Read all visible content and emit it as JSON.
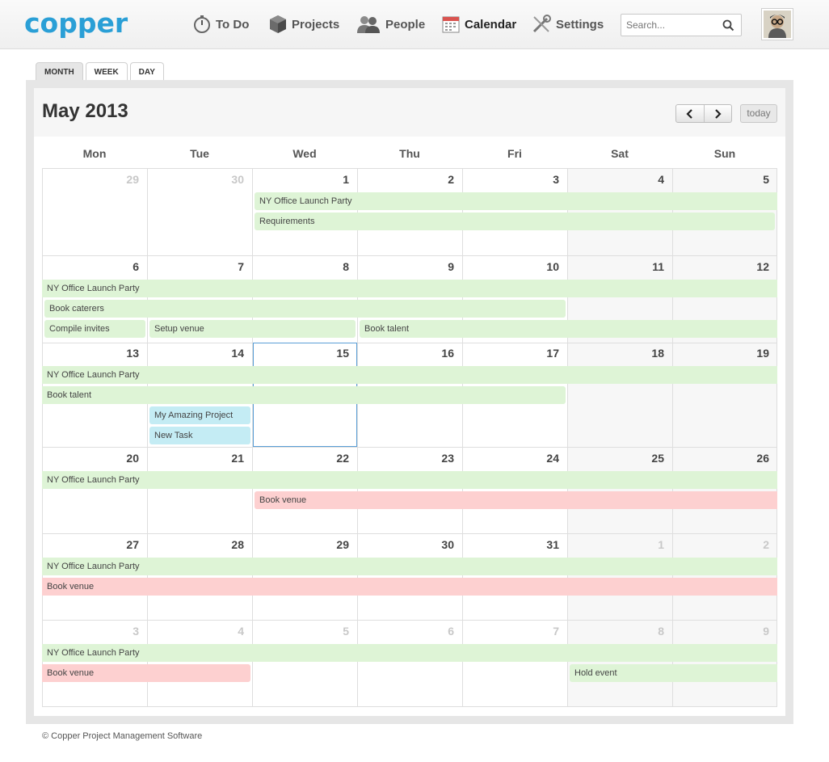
{
  "app": {
    "brand": "copper",
    "nav": [
      {
        "label": "To Do",
        "icon": "stopwatch-icon"
      },
      {
        "label": "Projects",
        "icon": "box-icon"
      },
      {
        "label": "People",
        "icon": "people-icon"
      },
      {
        "label": "Calendar",
        "icon": "calendar-icon",
        "active": true
      },
      {
        "label": "Settings",
        "icon": "wrench-icon"
      }
    ],
    "search_placeholder": "Search..."
  },
  "views": {
    "month": "MONTH",
    "week": "WEEK",
    "day": "DAY",
    "active": "month"
  },
  "calendar": {
    "title": "May 2013",
    "today_label": "today",
    "weekdays": [
      "Mon",
      "Tue",
      "Wed",
      "Thu",
      "Fri",
      "Sat",
      "Sun"
    ],
    "weeks": [
      [
        "29",
        "30",
        "1",
        "2",
        "3",
        "4",
        "5"
      ],
      [
        "6",
        "7",
        "8",
        "9",
        "10",
        "11",
        "12"
      ],
      [
        "13",
        "14",
        "15",
        "16",
        "17",
        "18",
        "19"
      ],
      [
        "20",
        "21",
        "22",
        "23",
        "24",
        "25",
        "26"
      ],
      [
        "27",
        "28",
        "29",
        "30",
        "31",
        "1",
        "2"
      ],
      [
        "3",
        "4",
        "5",
        "6",
        "7",
        "8",
        "9"
      ]
    ],
    "events": {
      "w1_party": "NY Office Launch Party",
      "w1_requirements": "Requirements",
      "w2_party": "NY Office Launch Party",
      "w2_caterers": "Book caterers",
      "w2_invites": "Compile invites",
      "w2_setup": "Setup venue",
      "w2_talent": "Book talent",
      "w3_party": "NY Office Launch Party",
      "w3_talent": "Book talent",
      "w3_project": "My Amazing Project",
      "w3_task": "New Task",
      "w4_party": "NY Office Launch Party",
      "w4_venue": "Book venue",
      "w5_party": "NY Office Launch Party",
      "w5_venue": "Book venue",
      "w6_party": "NY Office Launch Party",
      "w6_venue": "Book venue",
      "w6_hold": "Hold event"
    },
    "colors": {
      "green": "#def4d6",
      "red": "#fdd0d0",
      "blue": "#c4ecf4",
      "today_border": "#5a9ed6",
      "brand": "#2a9fd6"
    }
  },
  "footer": "© Copper Project Management Software"
}
